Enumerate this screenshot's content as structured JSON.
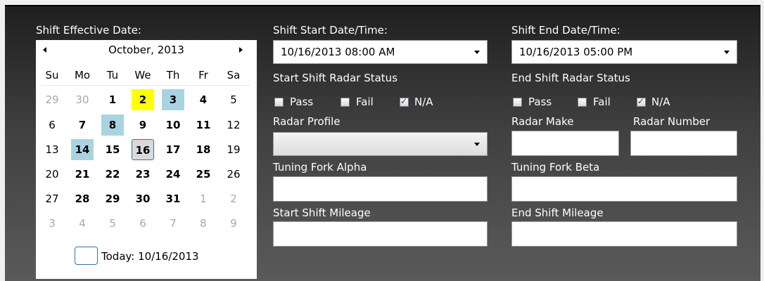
{
  "calendar": {
    "label": "Shift Effective Date:",
    "month_label": "October, 2013",
    "day_headers": [
      "Su",
      "Mo",
      "Tu",
      "We",
      "Th",
      "Fr",
      "Sa"
    ],
    "weeks": [
      [
        "29",
        "30",
        "1",
        "2",
        "3",
        "4",
        "5"
      ],
      [
        "6",
        "7",
        "8",
        "9",
        "10",
        "11",
        "12"
      ],
      [
        "13",
        "14",
        "15",
        "16",
        "17",
        "18",
        "19"
      ],
      [
        "20",
        "21",
        "22",
        "23",
        "24",
        "25",
        "26"
      ],
      [
        "27",
        "28",
        "29",
        "30",
        "31",
        "1",
        "2"
      ],
      [
        "3",
        "4",
        "5",
        "6",
        "7",
        "8",
        "9"
      ]
    ],
    "today_text": "Today: 10/16/2013",
    "colors": {
      "selected_blue": "#a9d3e1",
      "highlight_yellow": "#ffff00",
      "today_border": "#3b6fa8",
      "other_month": "#a8a8a8"
    }
  },
  "start": {
    "datetime_label": "Shift Start Date/Time:",
    "datetime_value": "10/16/2013 08:00 AM",
    "radar_status_label": "Start Shift Radar Status",
    "pass_label": "Pass",
    "fail_label": "Fail",
    "na_label": "N/A",
    "pass_checked": false,
    "fail_checked": false,
    "na_checked": true,
    "radar_profile_label": "Radar Profile",
    "radar_profile_value": "",
    "tuning_fork_alpha_label": "Tuning Fork Alpha",
    "tuning_fork_alpha_value": "",
    "mileage_label": "Start Shift Mileage",
    "mileage_value": ""
  },
  "end": {
    "datetime_label": "Shift End Date/Time:",
    "datetime_value": "10/16/2013 05:00 PM",
    "radar_status_label": "End Shift Radar Status",
    "pass_label": "Pass",
    "fail_label": "Fail",
    "na_label": "N/A",
    "pass_checked": false,
    "fail_checked": false,
    "na_checked": true,
    "radar_make_label": "Radar Make",
    "radar_make_value": "",
    "radar_number_label": "Radar Number",
    "radar_number_value": "",
    "tuning_fork_beta_label": "Tuning Fork Beta",
    "tuning_fork_beta_value": "",
    "mileage_label": "End Shift Mileage",
    "mileage_value": ""
  }
}
